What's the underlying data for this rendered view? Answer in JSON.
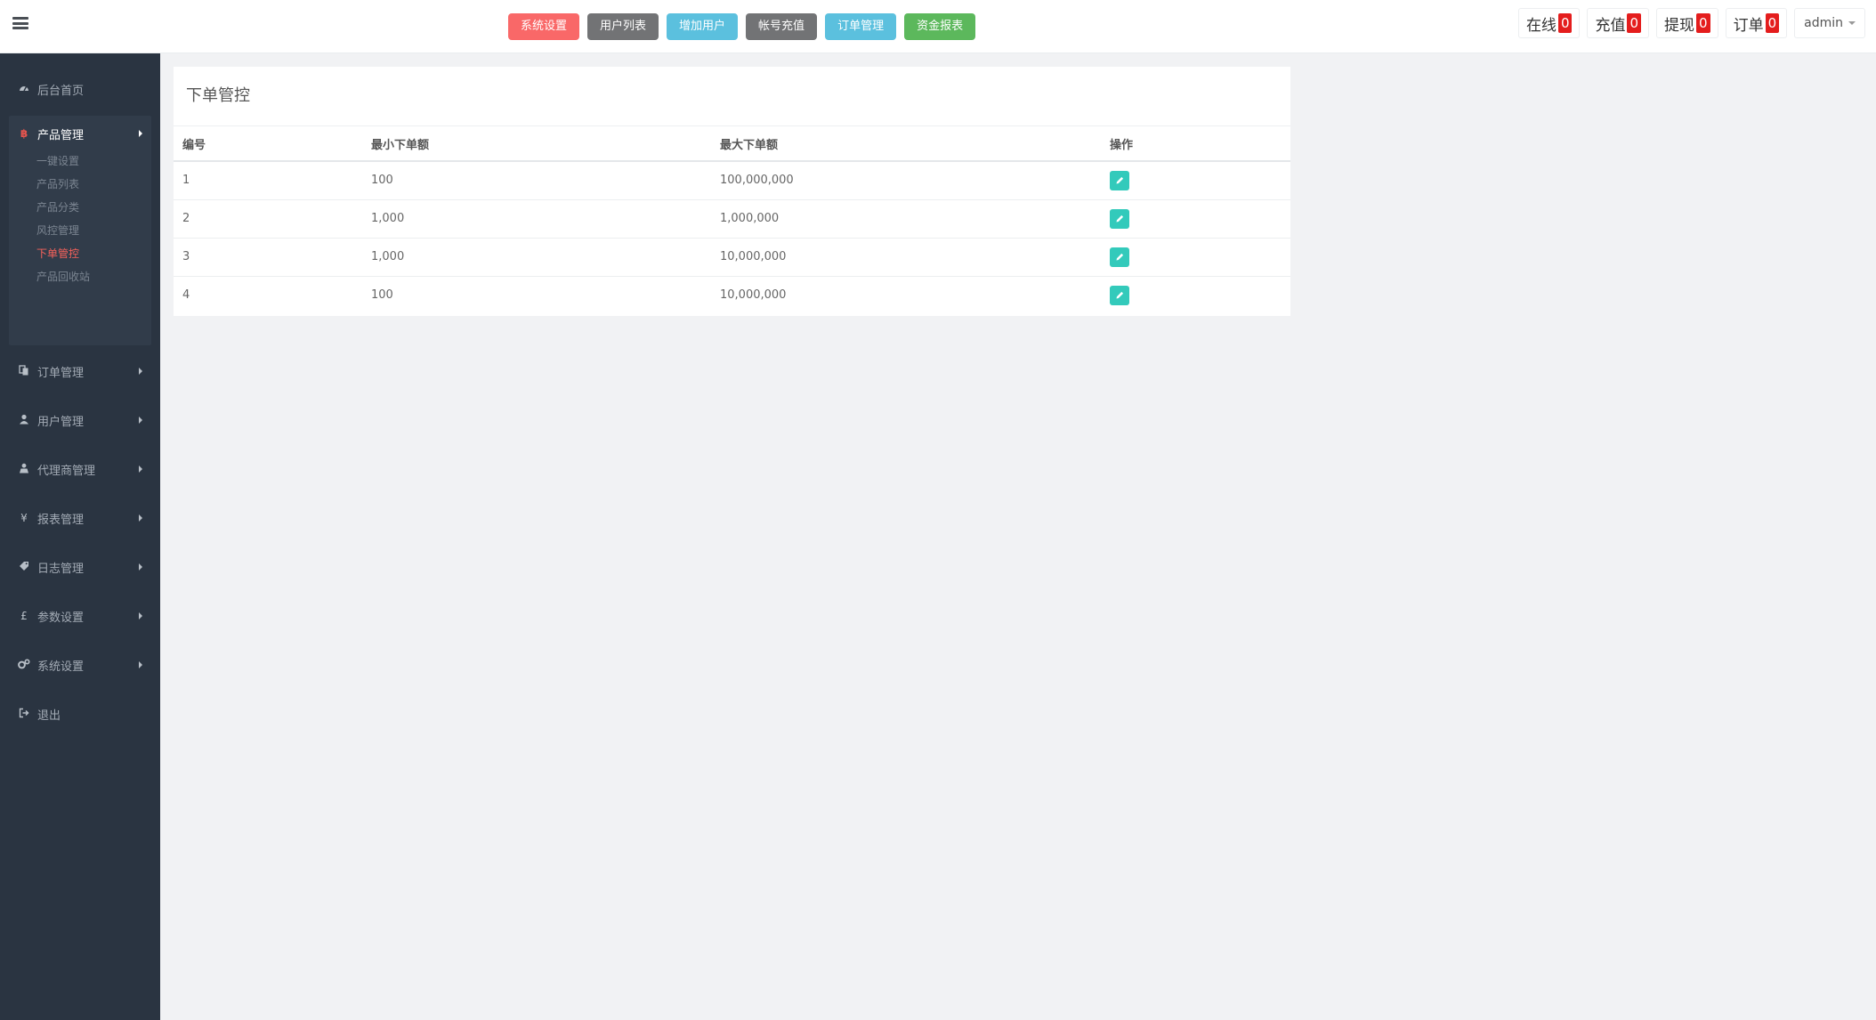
{
  "topbar": {
    "menu_icon": "hamburger-icon",
    "quick_buttons": [
      {
        "label": "系统设置",
        "color": "#f96868"
      },
      {
        "label": "用户列表",
        "color": "#727375"
      },
      {
        "label": "增加用户",
        "color": "#5bc0de"
      },
      {
        "label": "帐号充值",
        "color": "#727375"
      },
      {
        "label": "订单管理",
        "color": "#5bc0de"
      },
      {
        "label": "资金报表",
        "color": "#5cb85c"
      }
    ],
    "stats": [
      {
        "label": "在线",
        "count": "0"
      },
      {
        "label": "充值",
        "count": "0"
      },
      {
        "label": "提现",
        "count": "0"
      },
      {
        "label": "订单",
        "count": "0"
      }
    ],
    "user": "admin"
  },
  "sidebar": {
    "home": {
      "label": "后台首页",
      "icon": "dashboard-icon"
    },
    "product": {
      "label": "产品管理",
      "icon": "bitcoin-icon",
      "children": [
        "一键设置",
        "产品列表",
        "产品分类",
        "风控管理",
        "下单管控",
        "产品回收站"
      ],
      "active_child": "下单管控"
    },
    "items": [
      {
        "label": "订单管理",
        "icon": "copy-icon"
      },
      {
        "label": "用户管理",
        "icon": "user-icon"
      },
      {
        "label": "代理商管理",
        "icon": "agent-icon"
      },
      {
        "label": "报表管理",
        "icon": "yen-icon"
      },
      {
        "label": "日志管理",
        "icon": "tags-icon"
      },
      {
        "label": "参数设置",
        "icon": "pound-icon"
      },
      {
        "label": "系统设置",
        "icon": "gears-icon"
      }
    ],
    "logout": {
      "label": "退出",
      "icon": "sign-out-icon"
    }
  },
  "main": {
    "title": "下单管控",
    "columns": [
      "编号",
      "最小下单额",
      "最大下单额",
      "操作"
    ],
    "rows": [
      {
        "id": "1",
        "min": "100",
        "max": "100,000,000"
      },
      {
        "id": "2",
        "min": "1,000",
        "max": "1,000,000"
      },
      {
        "id": "3",
        "min": "1,000",
        "max": "10,000,000"
      },
      {
        "id": "4",
        "min": "100",
        "max": "10,000,000"
      }
    ],
    "action_icon": "pencil-icon",
    "accent_color": "#33cabb"
  }
}
